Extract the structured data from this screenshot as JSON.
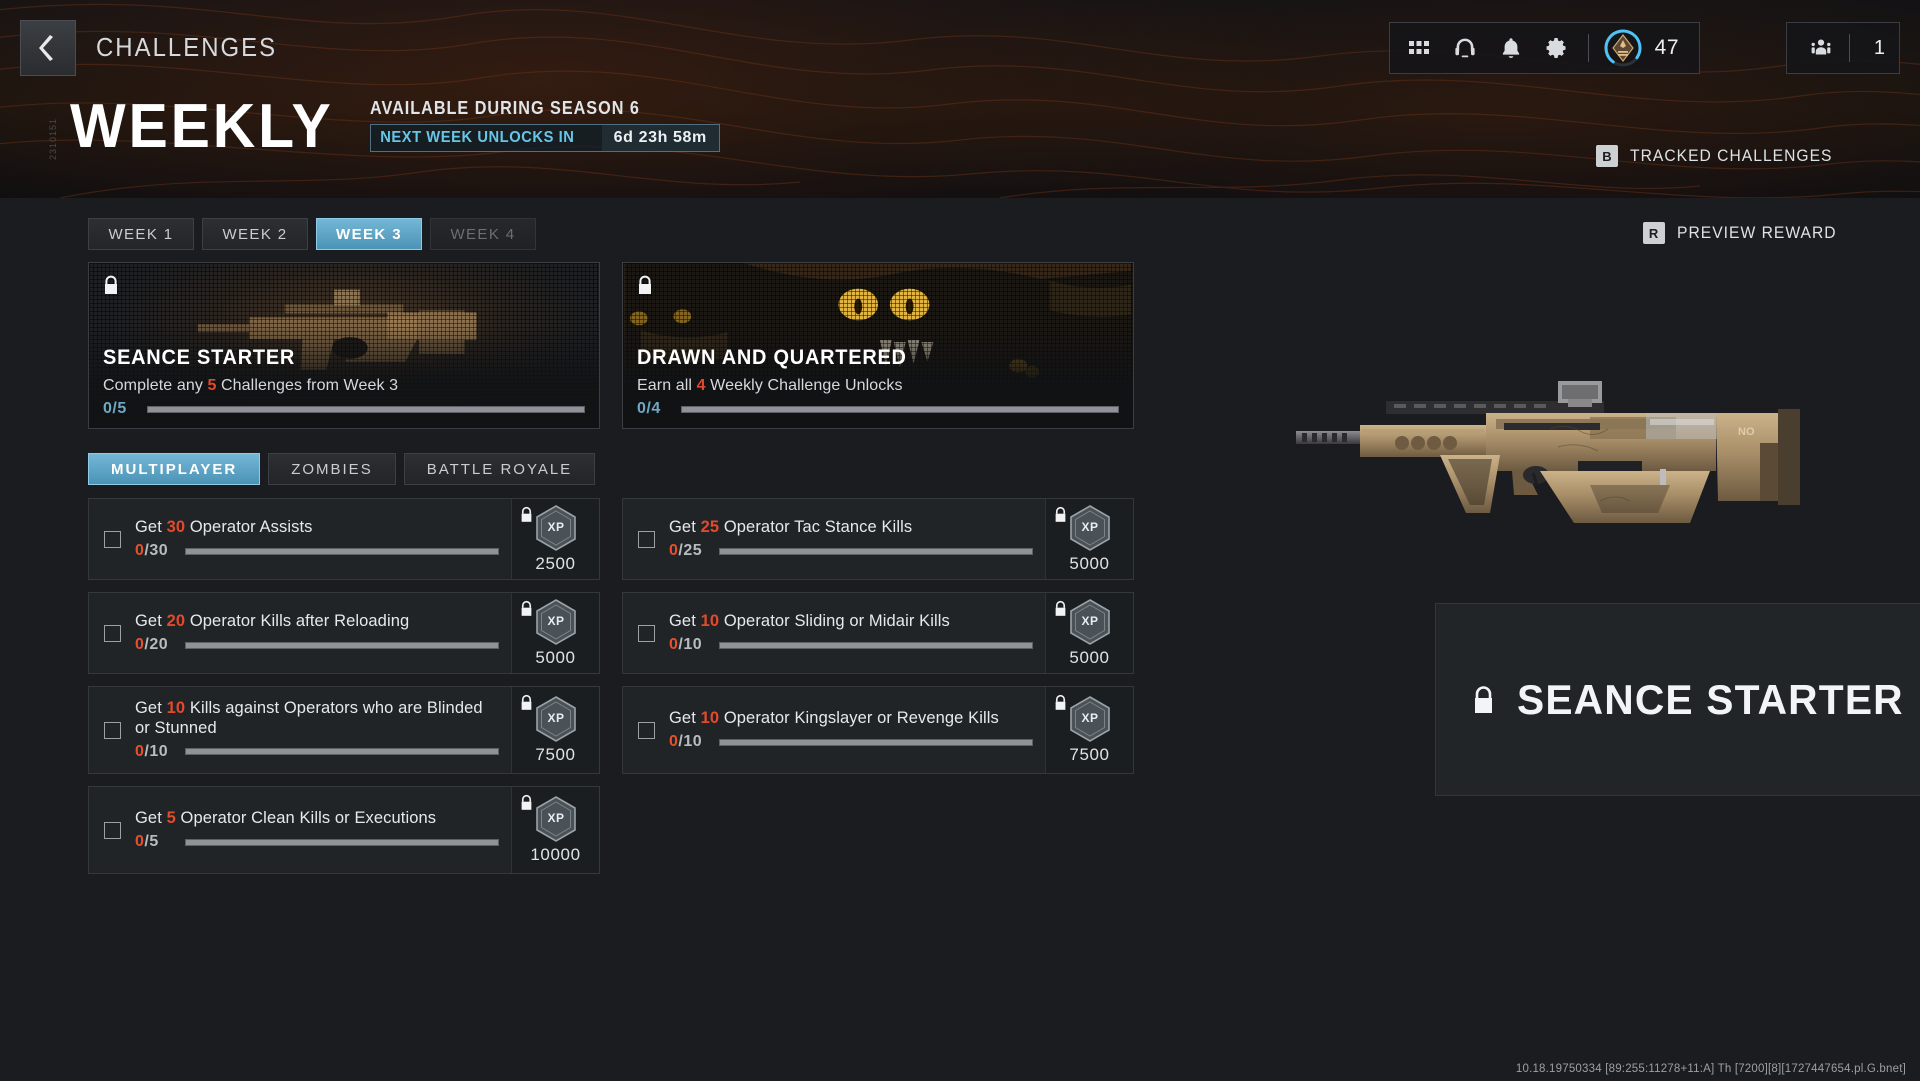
{
  "header": {
    "back_icon": "chevron-left-icon",
    "title": "CHALLENGES",
    "hud": {
      "icons": [
        {
          "name": "grid-apps-icon"
        },
        {
          "name": "headset-icon"
        },
        {
          "name": "bell-notifications-icon"
        },
        {
          "name": "gear-settings-icon"
        }
      ],
      "rank_value": "47",
      "party_value": "1"
    }
  },
  "hero": {
    "side_code": "2310151",
    "title": "WEEKLY",
    "availability": "AVAILABLE DURING SEASON 6",
    "timer_label": "NEXT WEEK UNLOCKS IN",
    "timer_value": "6d 23h 58m",
    "tracked_key": "B",
    "tracked_label": "TRACKED CHALLENGES"
  },
  "preview_button": {
    "key": "R",
    "label": "PREVIEW REWARD"
  },
  "week_tabs": [
    {
      "label": "WEEK 1",
      "state": "normal"
    },
    {
      "label": "WEEK 2",
      "state": "normal"
    },
    {
      "label": "WEEK 3",
      "state": "active"
    },
    {
      "label": "WEEK 4",
      "state": "locked"
    }
  ],
  "reward_cards": [
    {
      "title": "SEANCE STARTER",
      "desc_pre": "Complete any ",
      "desc_hl": "5",
      "desc_post": " Challenges from Week 3",
      "progress_text": "0/5",
      "progress_pct": 0,
      "locked": true,
      "art": "weapon-blueprint-art"
    },
    {
      "title": "DRAWN AND QUARTERED",
      "desc_pre": "Earn all ",
      "desc_hl": "4",
      "desc_post": " Weekly Challenge Unlocks",
      "progress_text": "0/4",
      "progress_pct": 0,
      "locked": true,
      "art": "creature-calling-card-art"
    }
  ],
  "mode_tabs": [
    {
      "label": "MULTIPLAYER",
      "state": "active"
    },
    {
      "label": "ZOMBIES",
      "state": "normal"
    },
    {
      "label": "BATTLE ROYALE",
      "state": "normal"
    }
  ],
  "challenges_left": [
    {
      "pre": "Get ",
      "hl": "30",
      "post": " Operator Assists",
      "current": "0",
      "goal": "/30",
      "progress_pct": 0,
      "xp": "2500",
      "locked": true,
      "checked": false
    },
    {
      "pre": "Get ",
      "hl": "20",
      "post": " Operator Kills after Reloading",
      "current": "0",
      "goal": "/20",
      "progress_pct": 0,
      "xp": "5000",
      "locked": true,
      "checked": false
    },
    {
      "pre": "Get ",
      "hl": "10",
      "post": " Kills against Operators who are Blinded or Stunned",
      "current": "0",
      "goal": "/10",
      "progress_pct": 0,
      "xp": "7500",
      "locked": true,
      "checked": false
    },
    {
      "pre": "Get ",
      "hl": "5",
      "post": " Operator Clean Kills or Executions",
      "current": "0",
      "goal": "/5",
      "progress_pct": 0,
      "xp": "10000",
      "locked": true,
      "checked": false
    }
  ],
  "challenges_right": [
    {
      "pre": "Get ",
      "hl": "25",
      "post": " Operator Tac Stance Kills",
      "current": "0",
      "goal": "/25",
      "progress_pct": 0,
      "xp": "5000",
      "locked": true,
      "checked": false
    },
    {
      "pre": "Get ",
      "hl": "10",
      "post": " Operator Sliding or Midair Kills",
      "current": "0",
      "goal": "/10",
      "progress_pct": 0,
      "xp": "5000",
      "locked": true,
      "checked": false
    },
    {
      "pre": "Get ",
      "hl": "10",
      "post": " Operator Kingslayer or Revenge Kills",
      "current": "0",
      "goal": "/10",
      "progress_pct": 0,
      "xp": "7500",
      "locked": true,
      "checked": false
    }
  ],
  "reward_preview": {
    "locked": true,
    "title": "SEANCE STARTER",
    "weapon": "bullpup-assault-rifle-blueprint"
  },
  "build_string": "10.18.19750334 [89:255:11278+11:A] Th [7200][8][1727447654.pl.G.bnet]",
  "colors": {
    "accent_blue": "#5bb4dd",
    "accent_cyan": "#67c6e8",
    "highlight_orange": "#e24a2c",
    "progress_current": "#e8502b",
    "panel_bg": "#1a1c1f",
    "card_bg": "#212427"
  }
}
